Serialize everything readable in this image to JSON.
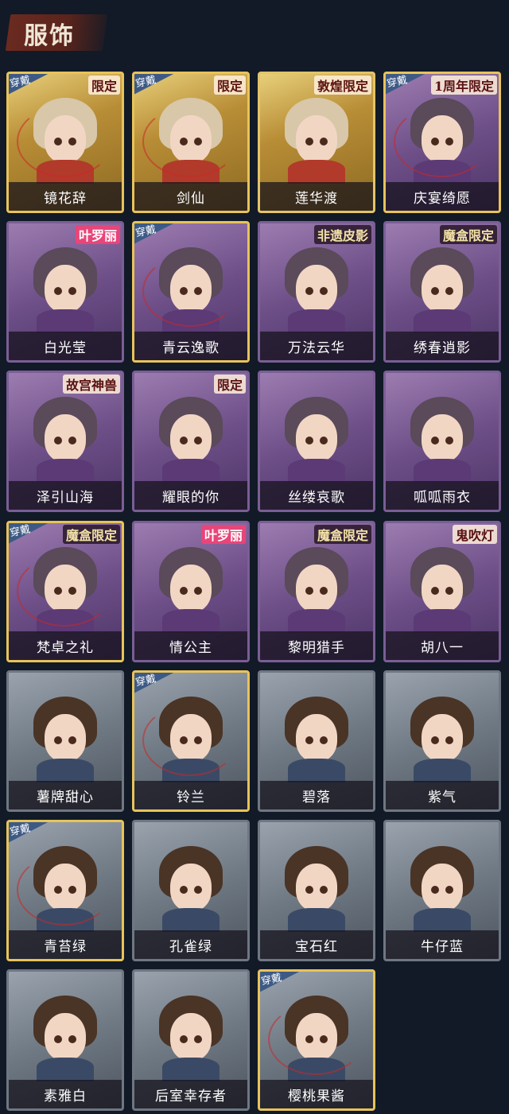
{
  "section_title": "服饰",
  "worn_label": "穿戴",
  "colors": {
    "background": "#111a26",
    "gold_frame": "#e3c46a",
    "purple_frame": "#7a5e95",
    "gray_frame": "#6e7782"
  },
  "costumes": [
    {
      "name": "镜花辞",
      "rarity": "gold",
      "equipped": true,
      "badge": "限定"
    },
    {
      "name": "剑仙",
      "rarity": "gold",
      "equipped": true,
      "badge": "限定"
    },
    {
      "name": "莲华渡",
      "rarity": "gold",
      "equipped": false,
      "badge": "敦煌限定"
    },
    {
      "name": "庆宴绮愿",
      "rarity": "purple",
      "equipped": true,
      "badge": "1周年限定"
    },
    {
      "name": "白光莹",
      "rarity": "purple",
      "equipped": false,
      "badge": "叶罗丽"
    },
    {
      "name": "青云逸歌",
      "rarity": "purple",
      "equipped": true,
      "badge": ""
    },
    {
      "name": "万法云华",
      "rarity": "purple",
      "equipped": false,
      "badge": "非遗皮影"
    },
    {
      "name": "绣春逍影",
      "rarity": "purple",
      "equipped": false,
      "badge": "魔盒限定"
    },
    {
      "name": "泽引山海",
      "rarity": "purple",
      "equipped": false,
      "badge": "故宫神兽"
    },
    {
      "name": "耀眼的你",
      "rarity": "purple",
      "equipped": false,
      "badge": "限定"
    },
    {
      "name": "丝缕哀歌",
      "rarity": "purple",
      "equipped": false,
      "badge": ""
    },
    {
      "name": "呱呱雨衣",
      "rarity": "purple",
      "equipped": false,
      "badge": ""
    },
    {
      "name": "梵卓之礼",
      "rarity": "purple",
      "equipped": true,
      "badge": "魔盒限定"
    },
    {
      "name": "情公主",
      "rarity": "purple",
      "equipped": false,
      "badge": "叶罗丽"
    },
    {
      "name": "黎明猎手",
      "rarity": "purple",
      "equipped": false,
      "badge": "魔盒限定"
    },
    {
      "name": "胡八一",
      "rarity": "purple",
      "equipped": false,
      "badge": "鬼吹灯"
    },
    {
      "name": "薯牌甜心",
      "rarity": "gray",
      "equipped": false,
      "badge": ""
    },
    {
      "name": "铃兰",
      "rarity": "gray",
      "equipped": true,
      "badge": ""
    },
    {
      "name": "碧落",
      "rarity": "gray",
      "equipped": false,
      "badge": ""
    },
    {
      "name": "紫气",
      "rarity": "gray",
      "equipped": false,
      "badge": ""
    },
    {
      "name": "青苔绿",
      "rarity": "gray",
      "equipped": true,
      "badge": ""
    },
    {
      "name": "孔雀绿",
      "rarity": "gray",
      "equipped": false,
      "badge": ""
    },
    {
      "name": "宝石红",
      "rarity": "gray",
      "equipped": false,
      "badge": ""
    },
    {
      "name": "牛仔蓝",
      "rarity": "gray",
      "equipped": false,
      "badge": ""
    },
    {
      "name": "素雅白",
      "rarity": "gray",
      "equipped": false,
      "badge": ""
    },
    {
      "name": "后室幸存者",
      "rarity": "gray",
      "equipped": false,
      "badge": ""
    },
    {
      "name": "樱桃果酱",
      "rarity": "gray",
      "equipped": true,
      "badge": ""
    }
  ]
}
